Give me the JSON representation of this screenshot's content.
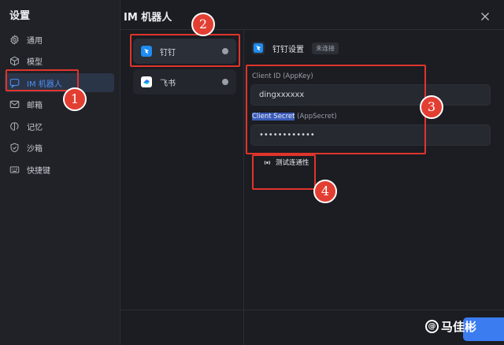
{
  "sidebar": {
    "title": "设置",
    "items": [
      {
        "label": "通用",
        "icon": "gear-icon"
      },
      {
        "label": "模型",
        "icon": "cube-icon"
      },
      {
        "label": "IM 机器人",
        "icon": "chat-icon"
      },
      {
        "label": "邮箱",
        "icon": "mail-icon"
      },
      {
        "label": "记忆",
        "icon": "brain-icon"
      },
      {
        "label": "沙箱",
        "icon": "shield-icon"
      },
      {
        "label": "快捷键",
        "icon": "keyboard-icon"
      }
    ]
  },
  "main": {
    "title": "IM 机器人",
    "bots": [
      {
        "label": "钉钉",
        "icon": "dingtalk-logo-icon"
      },
      {
        "label": "飞书",
        "icon": "feishu-logo-icon"
      }
    ],
    "panel": {
      "title": "钉钉设置",
      "status": "未连接",
      "client_id_label": "Client ID (AppKey)",
      "client_id_value": "dingxxxxxx",
      "client_secret_label_hl": "Client Secret",
      "client_secret_label_rest": " (AppSecret)",
      "client_secret_value": "••••••••••••",
      "test_button": "测试连通性"
    }
  },
  "annotations": [
    "1",
    "2",
    "3",
    "4"
  ],
  "watermark": {
    "icon_text": "@",
    "text": "马佳彬"
  },
  "colors": {
    "accent": "#3b7cf0",
    "active_text": "#4d8ff5",
    "annotation": "#e0342c"
  }
}
